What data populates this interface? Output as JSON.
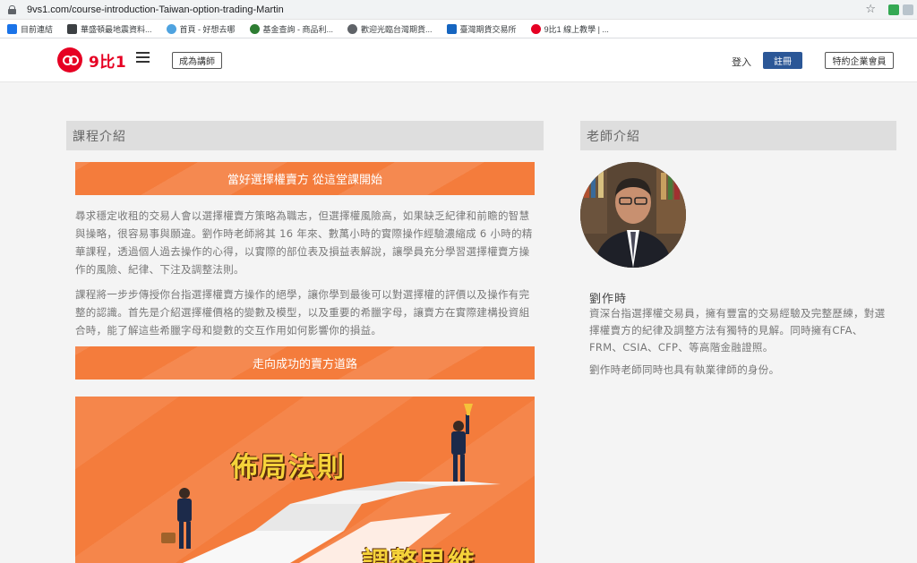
{
  "browser": {
    "url": "9vs1.com/course-introduction-Taiwan-option-trading-Martin",
    "bookmarks": [
      {
        "label": "目前連結",
        "color": "#1a73e8"
      },
      {
        "label": "華盛頓最地震資料...",
        "color": "#3c4043"
      },
      {
        "label": "首頁 - 好想去哪",
        "color": "#4fa3e0"
      },
      {
        "label": "基金查詢 - 商品利...",
        "color": "#2e7d32"
      },
      {
        "label": "歡迎光臨台灣期貨...",
        "color": "#5f6368"
      },
      {
        "label": "臺灣期貨交易所",
        "color": "#1565c0"
      },
      {
        "label": "9比1 線上教學 | ...",
        "color": "#e60023"
      }
    ]
  },
  "header": {
    "logo_text": "9比1",
    "teacher_button": "成為講師",
    "login": "登入",
    "register": "註冊",
    "member_button": "特約企業會員"
  },
  "course": {
    "section_title": "課程介紹",
    "banner1": "當好選擇權賣方 從這堂課開始",
    "para1": "尋求穩定收租的交易人會以選擇權賣方策略為職志，但選擇權風險高，如果缺乏紀律和前瞻的智慧與操略，很容易事與願違。劉作時老師將其 16 年來、數萬小時的實際操作經驗濃縮成 6 小時的精華課程，透過個人過去操作的心得，以實際的部位表及損益表解說，讓學員充分學習選擇權賣方操作的風險、紀律、下注及調整法則。",
    "para2": "課程將一步步傳授你台指選擇權賣方操作的絕學，讓你學到最後可以對選擇權的評價以及操作有完整的認識。首先是介紹選擇權價格的變數及模型，以及重要的希臘字母，讓賣方在實際建構投資組合時，能了解這些希臘字母和變數的交互作用如何影響你的損益。",
    "banner2": "走向成功的賣方道路",
    "hero_title1": "佈局法則",
    "hero_title2": "調整思維"
  },
  "teacher": {
    "section_title": "老師介紹",
    "name": "劉作時",
    "bio": "資深台指選擇權交易員，擁有豐富的交易經驗及完整歷練，對選擇權賣方的紀律及調整方法有獨特的見解。同時擁有CFA、FRM、CSIA、CFP、等高階金融證照。",
    "note": "劉作時老師同時也具有執業律師的身份。"
  },
  "colors": {
    "brand_red": "#e60023",
    "orange": "#f47c3c",
    "register_blue": "#2b5797"
  }
}
